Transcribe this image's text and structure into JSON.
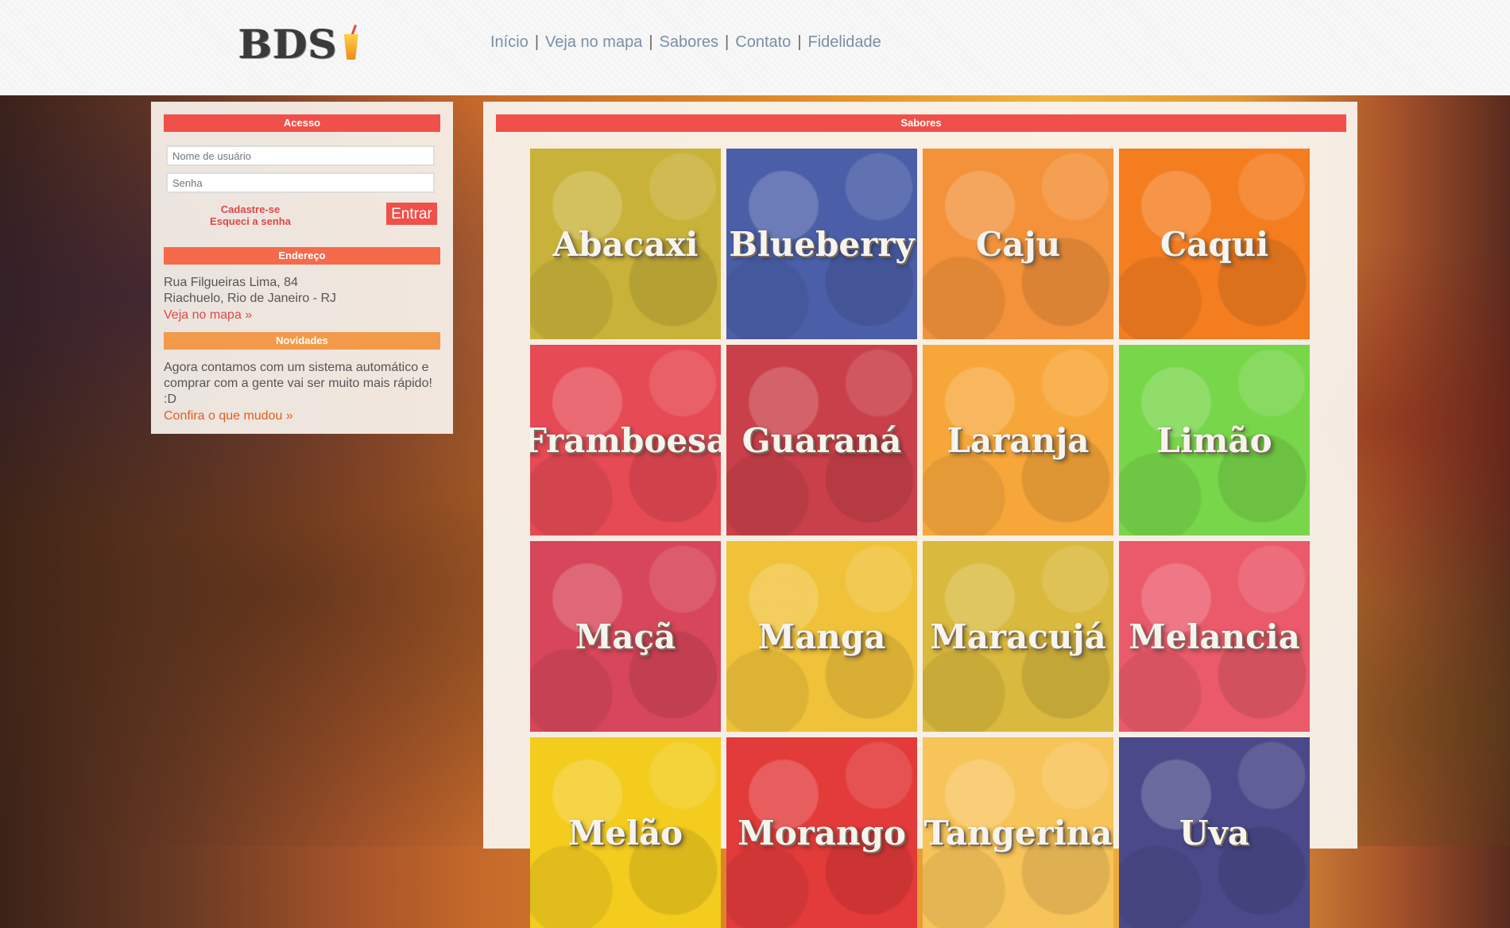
{
  "header": {
    "logo_text": "BDS",
    "nav": [
      {
        "label": "Início"
      },
      {
        "label": "Veja no mapa"
      },
      {
        "label": "Sabores"
      },
      {
        "label": "Contato"
      },
      {
        "label": "Fidelidade"
      }
    ],
    "nav_separator": "|"
  },
  "access": {
    "title": "Acesso",
    "username_placeholder": "Nome de usuário",
    "password_placeholder": "Senha",
    "signup_link": "Cadastre-se",
    "forgot_link": "Esqueci a senha",
    "login_button": "Entrar"
  },
  "address": {
    "title": "Endereço",
    "line1": "Rua Filgueiras Lima, 84",
    "line2": "Riachuelo, Rio de Janeiro - RJ",
    "map_link": "Veja no mapa »"
  },
  "news": {
    "title": "Novidades",
    "text": "Agora contamos com um sistema automático e comprar com a gente vai ser muito mais rápido! :D",
    "link": "Confira o que mudou »"
  },
  "flavors": {
    "title": "Sabores",
    "items": [
      {
        "label": "Abacaxi",
        "color": "#c9b23a"
      },
      {
        "label": "Blueberry",
        "color": "#4b5fa8"
      },
      {
        "label": "Caju",
        "color": "#f3923a"
      },
      {
        "label": "Caqui",
        "color": "#f47d20"
      },
      {
        "label": "Framboesa",
        "color": "#e64a54"
      },
      {
        "label": "Guaraná",
        "color": "#c9404a"
      },
      {
        "label": "Laranja",
        "color": "#f7a73a"
      },
      {
        "label": "Limão",
        "color": "#78d64a"
      },
      {
        "label": "Maçã",
        "color": "#d7465a"
      },
      {
        "label": "Manga",
        "color": "#f0c23a"
      },
      {
        "label": "Maracujá",
        "color": "#d9b93e"
      },
      {
        "label": "Melancia",
        "color": "#ea5a6a"
      },
      {
        "label": "Melão",
        "color": "#f3cc1e"
      },
      {
        "label": "Morango",
        "color": "#e33a3a"
      },
      {
        "label": "Tangerina",
        "color": "#f7c45a"
      },
      {
        "label": "Uva",
        "color": "#4a4a8a"
      }
    ]
  }
}
